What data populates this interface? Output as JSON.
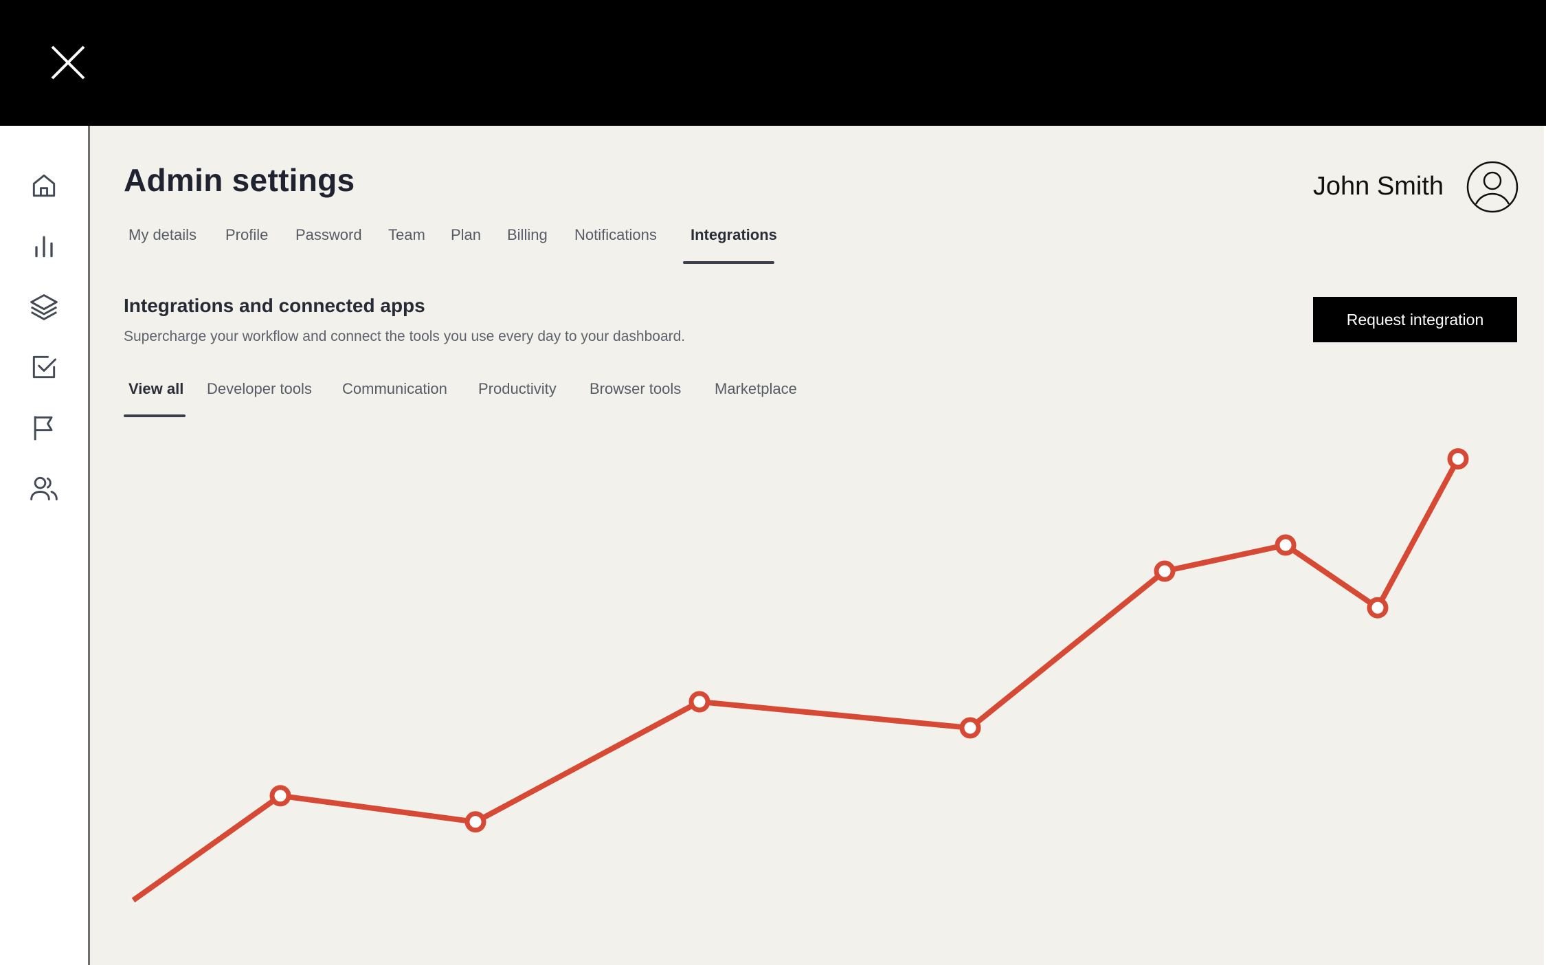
{
  "overlay": {
    "close_icon": "close-icon"
  },
  "sidebar": {
    "items": [
      {
        "name": "home",
        "icon": "home-icon"
      },
      {
        "name": "analytics",
        "icon": "bar-chart-icon"
      },
      {
        "name": "layers",
        "icon": "layers-icon"
      },
      {
        "name": "tasks",
        "icon": "check-square-icon"
      },
      {
        "name": "flags",
        "icon": "flag-icon"
      },
      {
        "name": "users",
        "icon": "users-icon"
      }
    ]
  },
  "header": {
    "title": "Admin settings",
    "user_name": "John Smith",
    "avatar_icon": "user-circle-icon"
  },
  "settings_tabs": {
    "items": [
      "My details",
      "Profile",
      "Password",
      "Team",
      "Plan",
      "Billing",
      "Notifications",
      "Integrations"
    ],
    "active": "Integrations"
  },
  "integrations": {
    "title": "Integrations and connected apps",
    "description": "Supercharge your workflow and connect the tools you use every day to your dashboard.",
    "request_button": "Request integration",
    "categories": {
      "items": [
        "View all",
        "Developer tools",
        "Communication",
        "Productivity",
        "Browser tools",
        "Marketplace"
      ],
      "active": "View all"
    }
  },
  "colors": {
    "background": "#f3f1ec",
    "line": "#d64a35",
    "text": "#1f2330",
    "button": "#000000"
  },
  "chart_data": {
    "type": "line",
    "x": [
      0,
      1,
      2,
      3,
      4,
      5,
      6,
      7,
      8
    ],
    "values": [
      14,
      54,
      44,
      90,
      80,
      140,
      150,
      126,
      183
    ],
    "markers_from_index": 1,
    "ylim": [
      0,
      200
    ],
    "grid": false,
    "legend": "none"
  }
}
